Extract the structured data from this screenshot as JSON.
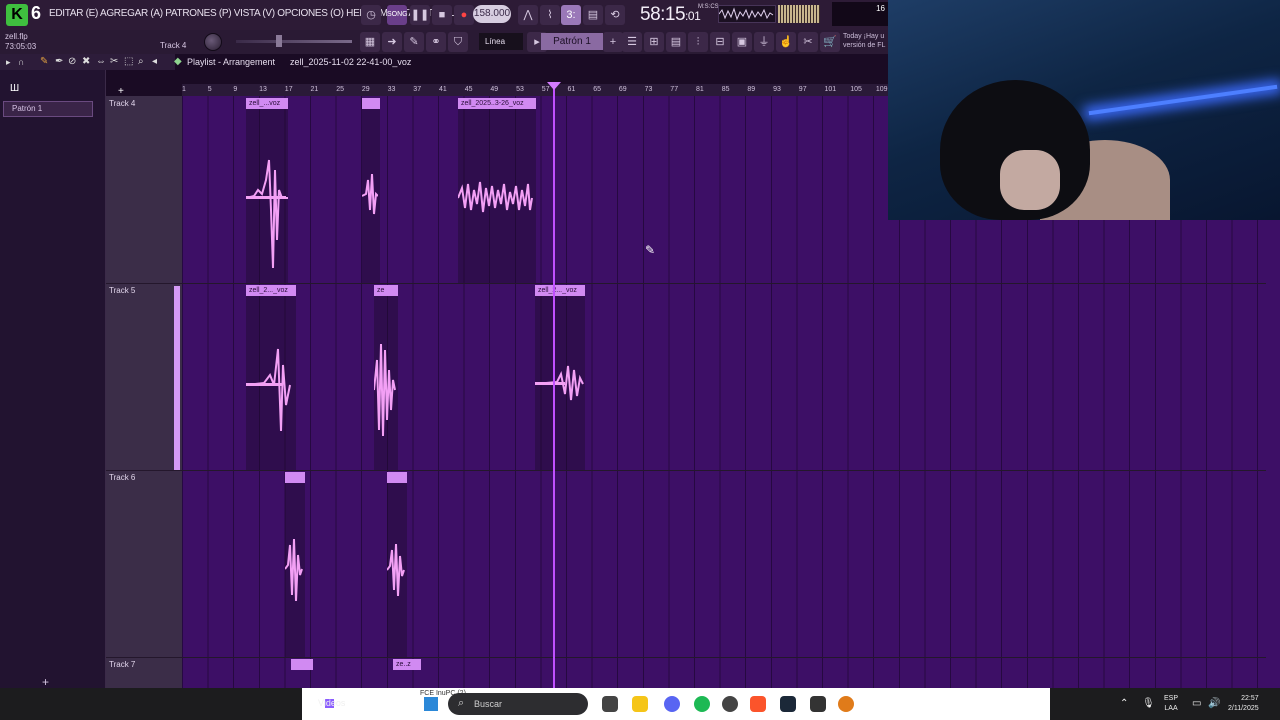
{
  "menubar": {
    "logo_letter": "K",
    "logo_version": "6",
    "menu_text": "EDITAR (E) AGREGAR (A) PATRONES (P) VISTA (V) OPCIONES (O) HERRAMIENTAS (T) AYUDA",
    "tempo": "158.000",
    "time": "58:15",
    "time_frames": "01",
    "time_small": "M:S:CS",
    "cpu_text": "16"
  },
  "toolbar2": {
    "file_name": "zell.flp",
    "file_time": "73:05:03",
    "track_hint": "Track 4",
    "snap_label": "Línea",
    "pattern_label": "Patrón 1",
    "news_text": "Today ¡Hay u versión de FL"
  },
  "browser": {
    "pattern_item": "Patrón 1",
    "add_label": "+"
  },
  "playlist": {
    "title": "Playlist - Arrangement",
    "breadcrumb": "zell_2025-11-02 22-41-00_voz",
    "ruler_ticks": [
      "1",
      "5",
      "9",
      "13",
      "17",
      "21",
      "25",
      "29",
      "33",
      "37",
      "41",
      "45",
      "49",
      "53",
      "57",
      "61",
      "65",
      "69",
      "73",
      "77",
      "81",
      "85",
      "89",
      "93",
      "97",
      "101",
      "105",
      "109"
    ],
    "tracks": [
      {
        "name": "Track 4",
        "clips": [
          {
            "label": "zell_...voz"
          },
          {
            "label": ""
          },
          {
            "label": "zell_2025..3-26_voz"
          }
        ]
      },
      {
        "name": "Track 5",
        "clips": [
          {
            "label": "zell_2..._voz"
          },
          {
            "label": "ze"
          },
          {
            "label": "zell_2..._voz"
          }
        ]
      },
      {
        "name": "Track 6",
        "clips": [
          {
            "label": ""
          },
          {
            "label": ""
          }
        ]
      },
      {
        "name": "Track 7",
        "clips": [
          {
            "label": ""
          },
          {
            "label": "ze..z"
          }
        ]
      }
    ]
  },
  "taskbar": {
    "videos_label": "Videos",
    "search_placeholder": "Buscar",
    "preview_text": "FCE InuPC (2)",
    "lang_top": "ESP",
    "lang_bottom": "LAA",
    "clock_time": "22:57",
    "clock_date": "2/11/2025"
  },
  "colors": {
    "accent": "#c050ff",
    "clip_label": "#d18af2",
    "waveform": "#f3a0f5",
    "grid_bg": "#3d0f66"
  }
}
